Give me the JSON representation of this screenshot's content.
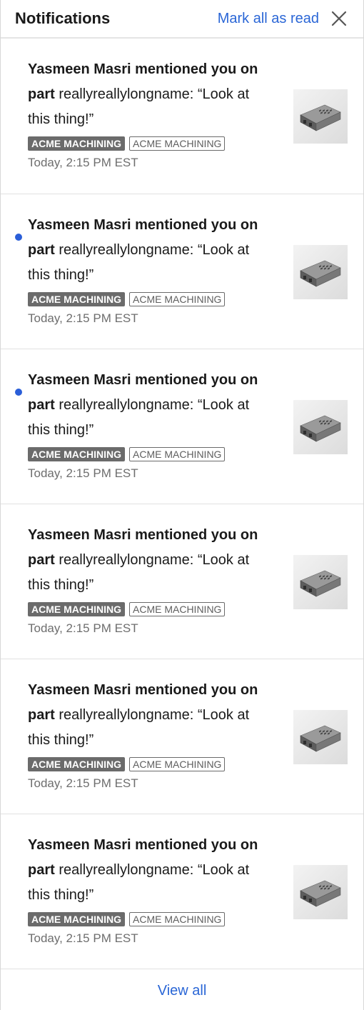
{
  "header": {
    "title": "Notifications",
    "mark_all_label": "Mark all as read",
    "close_icon": "close-icon"
  },
  "colors": {
    "link": "#2a66d6",
    "unread_dot": "#2a5ed8",
    "tag_fill": "#6b6b6b"
  },
  "notifications": [
    {
      "unread": false,
      "actor_action": "Yasmeen Masri mentioned you on",
      "object_type": "part",
      "message": " reallyreallylongname: “Look at this thing!”",
      "tags": [
        "ACME MACHINING",
        "ACME MACHINING"
      ],
      "timestamp": "Today, 2:15 PM EST",
      "thumbnail_icon": "part-thumbnail"
    },
    {
      "unread": true,
      "actor_action": "Yasmeen Masri mentioned you on",
      "object_type": "part",
      "message": " reallyreallylongname: “Look at this thing!”",
      "tags": [
        "ACME MACHINING",
        "ACME MACHINING"
      ],
      "timestamp": "Today, 2:15 PM EST",
      "thumbnail_icon": "part-thumbnail"
    },
    {
      "unread": true,
      "actor_action": "Yasmeen Masri mentioned you on",
      "object_type": "part",
      "message": " reallyreallylongname: “Look at this thing!”",
      "tags": [
        "ACME MACHINING",
        "ACME MACHINING"
      ],
      "timestamp": "Today, 2:15 PM EST",
      "thumbnail_icon": "part-thumbnail"
    },
    {
      "unread": false,
      "actor_action": "Yasmeen Masri mentioned you on",
      "object_type": "part",
      "message": " reallyreallylongname: “Look at this thing!”",
      "tags": [
        "ACME MACHINING",
        "ACME MACHINING"
      ],
      "timestamp": "Today, 2:15 PM EST",
      "thumbnail_icon": "part-thumbnail"
    },
    {
      "unread": false,
      "actor_action": "Yasmeen Masri mentioned you on",
      "object_type": "part",
      "message": " reallyreallylongname: “Look at this thing!”",
      "tags": [
        "ACME MACHINING",
        "ACME MACHINING"
      ],
      "timestamp": "Today, 2:15 PM EST",
      "thumbnail_icon": "part-thumbnail"
    },
    {
      "unread": false,
      "actor_action": "Yasmeen Masri mentioned you on",
      "object_type": "part",
      "message": " reallyreallylongname: “Look at this thing!”",
      "tags": [
        "ACME MACHINING",
        "ACME MACHINING"
      ],
      "timestamp": "Today, 2:15 PM EST",
      "thumbnail_icon": "part-thumbnail"
    }
  ],
  "footer": {
    "view_all_label": "View all"
  }
}
